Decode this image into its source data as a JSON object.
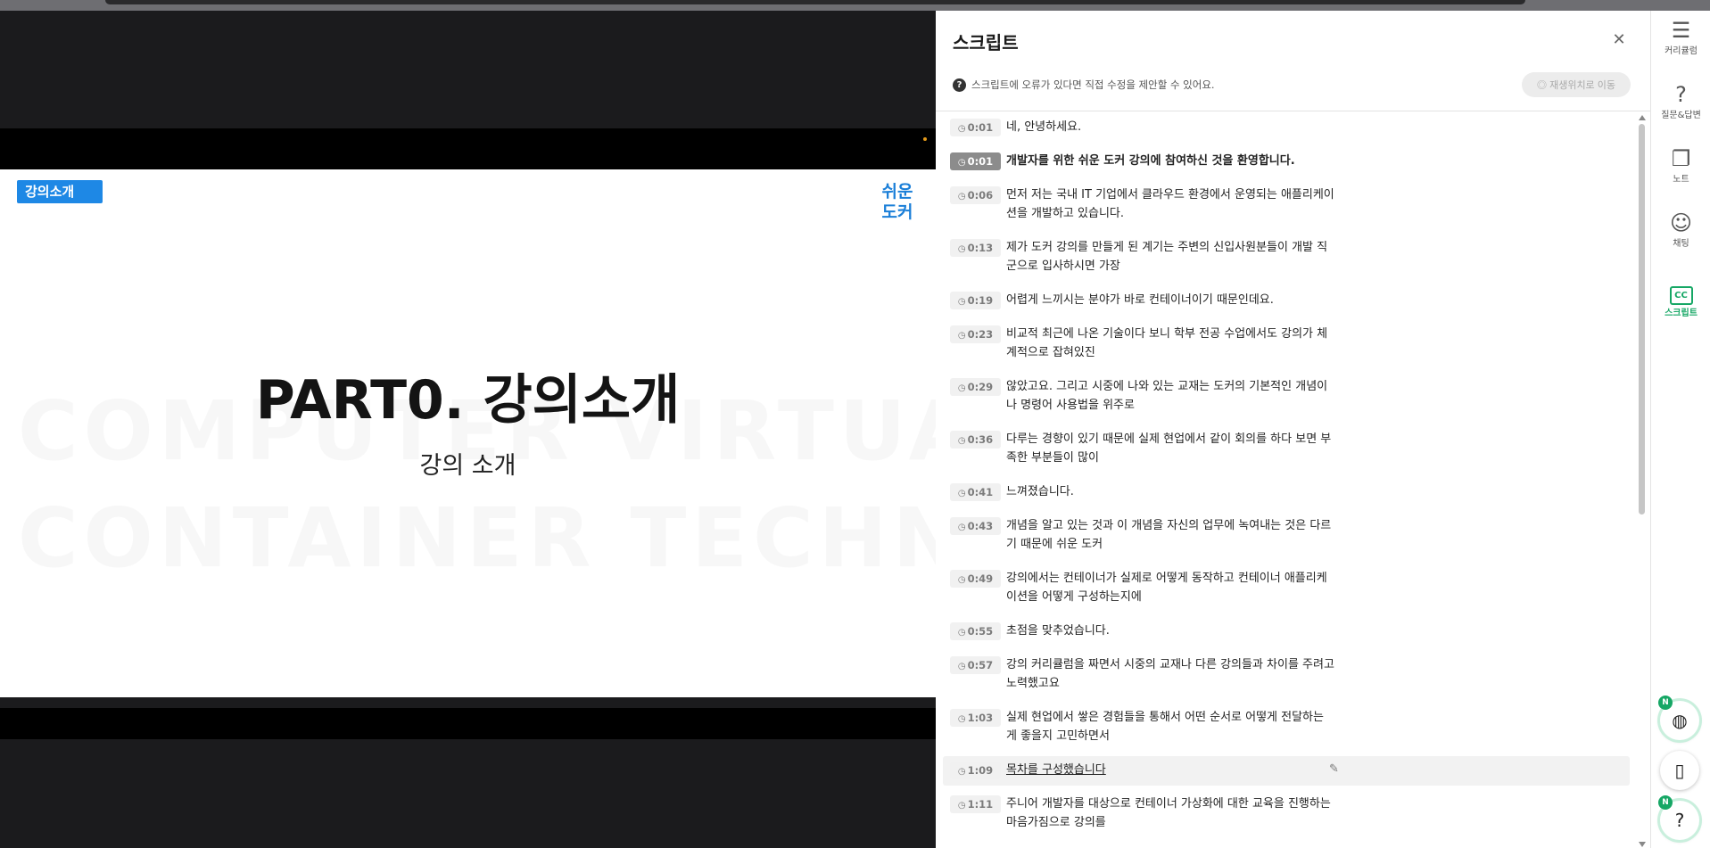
{
  "slide": {
    "tag": "강의소개",
    "logo_line1": "쉬운",
    "logo_line2": "도커",
    "title": "PART0. 강의소개",
    "subtitle": "강의 소개",
    "watermark1": "COMPUTER VIRTUALIZATION",
    "watermark2": "CONTAINER TECHNOLOGY DOCKER"
  },
  "panel": {
    "title": "스크립트",
    "close_icon": "close-icon",
    "notice": "스크립트에 오류가 있다면 직접 수정을 제안할 수 있어요.",
    "jump_button": "재생위치로 이동"
  },
  "transcript": [
    {
      "time": "0:01",
      "text": "네, 안녕하세요."
    },
    {
      "time": "0:01",
      "text": "개발자를 위한 쉬운 도커 강의에 참여하신 것을 환영합니다.",
      "active": true
    },
    {
      "time": "0:06",
      "text": "먼저 저는 국내 IT 기업에서 클라우드 환경에서 운영되는 애플리케이\n션을 개발하고 있습니다."
    },
    {
      "time": "0:13",
      "text": "제가 도커 강의를 만들게 된 계기는 주변의 신입사원분들이 개발 직\n군으로 입사하시면 가장"
    },
    {
      "time": "0:19",
      "text": "어렵게 느끼시는 분야가 바로 컨테이너이기 때문인데요."
    },
    {
      "time": "0:23",
      "text": "비교적 최근에 나온 기술이다 보니 학부 전공 수업에서도 강의가 체\n계적으로 잡혀있진"
    },
    {
      "time": "0:29",
      "text": "않았고요. 그리고 시중에 나와 있는 교재는 도커의 기본적인 개념이\n나 명령어 사용법을 위주로"
    },
    {
      "time": "0:36",
      "text": "다루는 경향이 있기 때문에 실제 현업에서 같이 회의를 하다 보면 부\n족한 부분들이 많이"
    },
    {
      "time": "0:41",
      "text": "느껴졌습니다."
    },
    {
      "time": "0:43",
      "text": "개념을 알고 있는 것과 이 개념을 자신의 업무에 녹여내는 것은 다르\n기 때문에 쉬운 도커"
    },
    {
      "time": "0:49",
      "text": "강의에서는 컨테이너가 실제로 어떻게 동작하고 컨테이너 애플리케\n이션을 어떻게 구성하는지에"
    },
    {
      "time": "0:55",
      "text": "초점을 맞추었습니다."
    },
    {
      "time": "0:57",
      "text": "강의 커리큘럼을 짜면서 시중의 교재나 다른 강의들과 차이를 주려고\n노력했고요"
    },
    {
      "time": "1:03",
      "text": "실제 현업에서 쌓은 경험들을 통해서 어떤 순서로 어떻게 전달하는\n게 좋을지 고민하면서"
    },
    {
      "time": "1:09",
      "text": "목차를 구성했습니다",
      "hover": true
    },
    {
      "time": "1:11",
      "text": "주니어 개발자를 대상으로 컨테이너 가상화에 대한 교육을 진행하는\n마음가짐으로 강의를"
    }
  ],
  "rail": [
    {
      "label": "커리큘럼",
      "icon": "curriculum-icon"
    },
    {
      "label": "질문&답변",
      "icon": "question-icon"
    },
    {
      "label": "노트",
      "icon": "note-icon"
    },
    {
      "label": "채팅",
      "icon": "chat-icon"
    },
    {
      "label": "스크립트",
      "icon": "cc-icon",
      "cc": "CC",
      "active": true
    }
  ],
  "fabs": {
    "badge": "N",
    "help": "?"
  },
  "colors": {
    "accent": "#16a765",
    "slide_tag": "#1e88e5",
    "logo": "#1b7fd8"
  }
}
